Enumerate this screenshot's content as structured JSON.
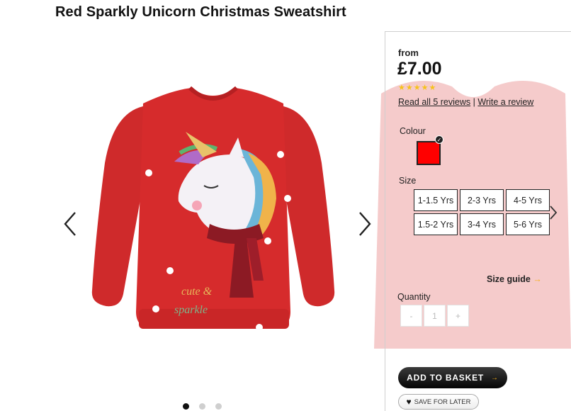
{
  "product": {
    "title": "Red Sparkly Unicorn Christmas Sweatshirt",
    "image_text_line1": "cute &",
    "image_text_line2": "sparkle"
  },
  "gallery": {
    "dots": [
      true,
      false,
      false
    ],
    "prev_icon": "chevron-left-icon",
    "next_icon": "chevron-right-icon"
  },
  "panel": {
    "from_label": "from",
    "price": "£7.00",
    "rating_stars": 5,
    "read_reviews": "Read all 5 reviews",
    "separator": "|",
    "write_review": "Write a review",
    "colour_label": "Colour",
    "colour_swatch": "#ff0000",
    "size_label": "Size",
    "sizes": [
      "1-1.5 Yrs",
      "2-3 Yrs",
      "4-5 Yrs",
      "1.5-2 Yrs",
      "3-4 Yrs",
      "5-6 Yrs"
    ],
    "size_guide": "Size guide",
    "quantity_label": "Quantity",
    "qty_minus": "-",
    "qty_value": "1",
    "qty_plus": "+",
    "add_to_basket": "ADD TO BASKET",
    "save_for_later": "SAVE FOR LATER"
  },
  "colors": {
    "sweatshirt_red": "#d62b2c",
    "star_yellow": "#f6c21b",
    "accent_arrow": "#f6b01b"
  }
}
